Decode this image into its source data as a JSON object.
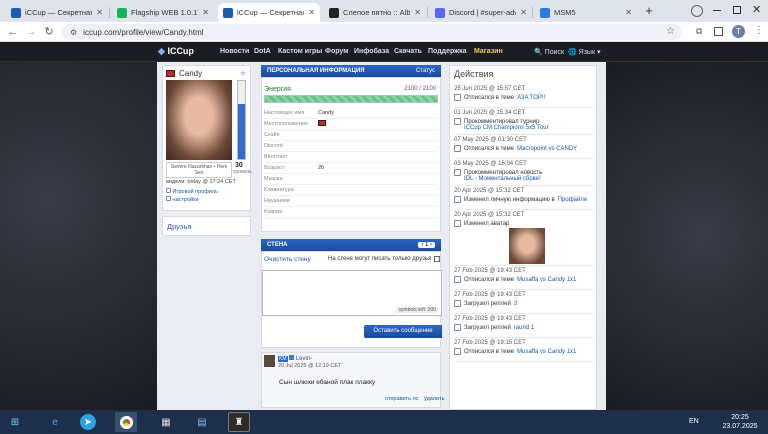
{
  "browser": {
    "tabs": [
      {
        "title": "iCCup — Секретная",
        "favicon_color": "#1e5bb5",
        "active": false
      },
      {
        "title": "Flagship WEB 1.0.17",
        "favicon_color": "#18b35c",
        "active": false
      },
      {
        "title": "iCCup — Секретная",
        "favicon_color": "#1e5bb5",
        "active": true
      },
      {
        "title": "Слепое пятно :: Alb",
        "favicon_color": "#222222",
        "active": false
      },
      {
        "title": "Discord | #super-adv",
        "favicon_color": "#5865f2",
        "active": false
      },
      {
        "title": "MSM5",
        "favicon_color": "#2c7be5",
        "active": false
      }
    ],
    "new_tab": "+",
    "url": "iccup.com/profile/view/Candy.html",
    "profile_initial": "T"
  },
  "site": {
    "logo": "ICCup",
    "nav": [
      "Новости",
      "DotA",
      "Кастом игры",
      "Форум",
      "Инфобаза",
      "Скачать",
      "Поддержка",
      "Магазин"
    ],
    "search": "Поиск",
    "language": "Язык"
  },
  "profile": {
    "username": "Candy",
    "rank_level": "30",
    "rank_label": "уровень",
    "name_line": "Severe Nazarkhan • Heni Sex",
    "last_seen": "видели: today @ 17:24 CET",
    "links": [
      "Игровой профиль",
      "настройки"
    ],
    "friends_title": "Друзья"
  },
  "info": {
    "header": "ПЕРСОНАЛЬНАЯ ИНФОРМАЦИЯ",
    "status_label": "Статус",
    "energy_label": "Энергия",
    "energy_value": "2100 / 2100",
    "energy_fraction": 1.0,
    "rows": [
      {
        "label": "Настоящее имя",
        "value": "Candy"
      },
      {
        "label": "Местоположение",
        "value": ""
      },
      {
        "label": "Скайп",
        "value": ""
      },
      {
        "label": "Discord",
        "value": ""
      },
      {
        "label": "ВКонтакт",
        "value": ""
      },
      {
        "label": "Возраст",
        "value": "26"
      },
      {
        "label": "Мышка",
        "value": ""
      },
      {
        "label": "Клавиатура",
        "value": ""
      },
      {
        "label": "Наушники",
        "value": ""
      },
      {
        "label": "Коврик",
        "value": ""
      }
    ]
  },
  "wall": {
    "header": "СТЕНА",
    "pager": "1",
    "clear_link": "Очистить стену",
    "friends_only_label": "На стене могут писать только друзья",
    "symbols_left": "symbols left: 200",
    "submit": "Оставить сообщение",
    "post": {
      "badge": "KM",
      "author": "Levin-",
      "date": "20 Jul 2025 @ 12:19 CET",
      "text": "Сын шлюхи ебаной плак плакку",
      "reply": "отправить лс",
      "delete": "удалить"
    }
  },
  "activity": {
    "title": "Действия",
    "items": [
      {
        "date": "25 Jun 2025 @ 15:57 CET",
        "text": "Отписался в теме",
        "link": "A3A TOP!!"
      },
      {
        "date": "01 Jun 2025 @ 15:34 CET",
        "text": "Прокомментировал турнир",
        "link": "ICCup CM Champions 5x5 Tour"
      },
      {
        "date": "07 May 2025 @ 01:30 CET",
        "text": "Отписался в теме",
        "link": "Macropoint vs CANDY"
      },
      {
        "date": "03 May 2025 @ 16:04 CET",
        "text": "Прокомментировал новость",
        "link": "IDL - Моментальный сбрве!"
      },
      {
        "date": "20 Apr 2025 @ 15:32 CET",
        "text": "Изменил личную информацию в",
        "link": "Профайле"
      },
      {
        "date": "20 Apr 2025 @ 15:32 CET",
        "text": "Изменил аватар",
        "link": ""
      },
      {
        "date": "27 Feb 2025 @ 19:43 CET",
        "text": "Отписался в теме",
        "link": "Musaffa vs Candy 1x1"
      },
      {
        "date": "27 Feb 2025 @ 19:43 CET",
        "text": "Загрузил реплей",
        "link": "3"
      },
      {
        "date": "27 Feb 2025 @ 19:43 CET",
        "text": "Загрузил реплей",
        "link": "raund 1"
      },
      {
        "date": "27 Feb 2025 @ 19:15 CET",
        "text": "Отписался в теме",
        "link": "Musaffa vs Candy 1x1"
      }
    ]
  },
  "taskbar": {
    "lang": "EN",
    "time": "20:25",
    "date": "23.07.2025"
  }
}
